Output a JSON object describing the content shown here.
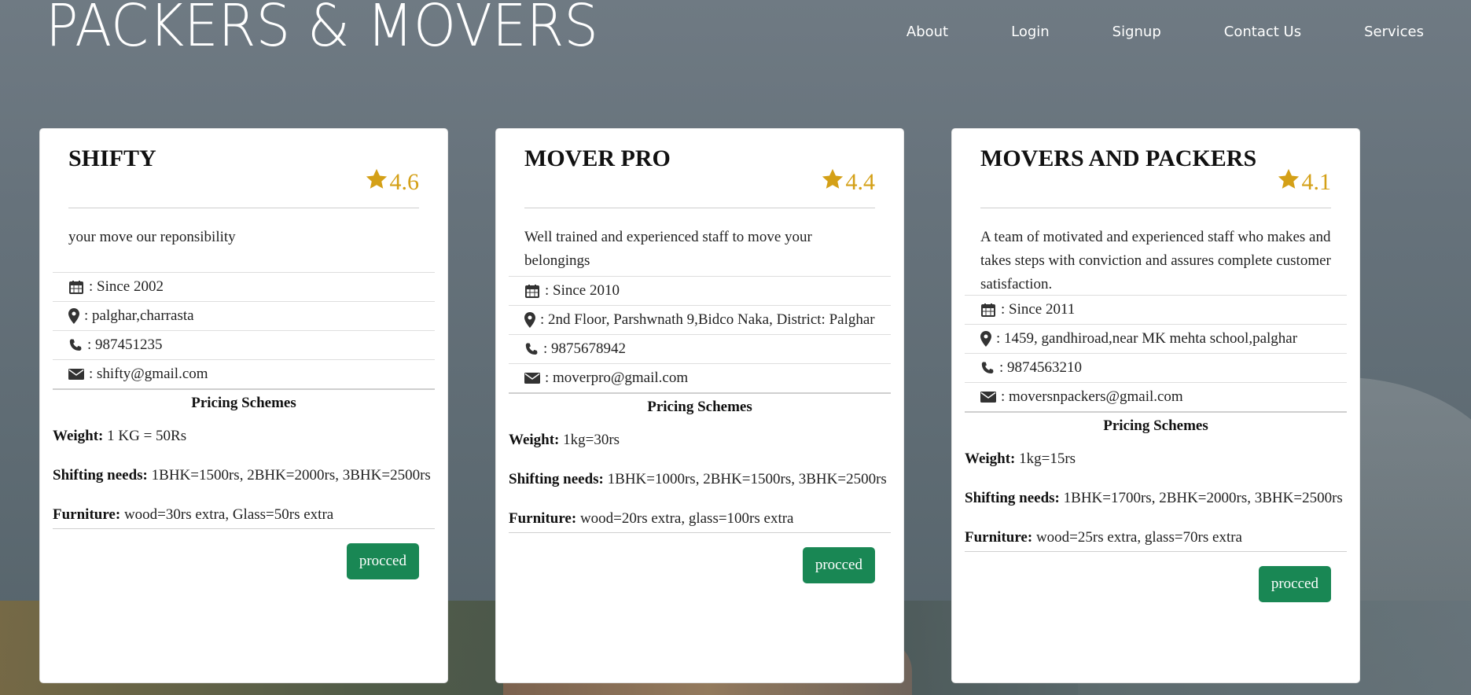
{
  "header": {
    "brand": "PACKERS & MOVERS",
    "nav": [
      "About",
      "Login",
      "Signup",
      "Contact Us",
      "Services"
    ]
  },
  "colors": {
    "rating_star": "#d4a017",
    "button": "#198754"
  },
  "icons": [
    "star-icon",
    "calendar-icon",
    "map-marker-icon",
    "phone-icon",
    "envelope-icon"
  ],
  "cards": [
    {
      "title": "SHIFTY",
      "rating": "4.6",
      "tagline": "your move our reponsibility",
      "since": ": Since 2002",
      "address": ": palghar,charrasta",
      "phone": ": 987451235",
      "email": ": shifty@gmail.com",
      "pricing_title": "Pricing Schemes",
      "weight_label": "Weight:",
      "weight": " 1 KG = 50Rs",
      "shifting_label": "Shifting needs:",
      "shifting": " 1BHK=1500rs, 2BHK=2000rs, 3BHK=2500rs",
      "furniture_label": "Furniture:",
      "furniture": " wood=30rs extra, Glass=50rs extra",
      "button": "procced"
    },
    {
      "title": "MOVER PRO",
      "rating": "4.4",
      "tagline": "Well trained and experienced staff to move your belongings",
      "since": ": Since 2010",
      "address": ": 2nd Floor, Parshwnath 9,Bidco Naka, District: Palghar",
      "phone": ": 9875678942",
      "email": ": moverpro@gmail.com",
      "pricing_title": "Pricing Schemes",
      "weight_label": "Weight:",
      "weight": " 1kg=30rs",
      "shifting_label": "Shifting needs:",
      "shifting": " 1BHK=1000rs, 2BHK=1500rs, 3BHK=2500rs",
      "furniture_label": "Furniture:",
      "furniture": " wood=20rs extra, glass=100rs extra",
      "button": "procced"
    },
    {
      "title": "MOVERS AND PACKERS",
      "rating": "4.1",
      "tagline": "A team of motivated and experienced staff who makes and takes steps with conviction and assures complete customer satisfaction.",
      "since": ": Since 2011",
      "address": ": 1459, gandhiroad,near MK mehta school,palghar",
      "phone": ": 9874563210",
      "email": ": moversnpackers@gmail.com",
      "pricing_title": "Pricing Schemes",
      "weight_label": "Weight:",
      "weight": " 1kg=15rs",
      "shifting_label": "Shifting needs:",
      "shifting": " 1BHK=1700rs, 2BHK=2000rs, 3BHK=2500rs",
      "furniture_label": "Furniture:",
      "furniture": " wood=25rs extra, glass=70rs extra",
      "button": "procced"
    }
  ]
}
